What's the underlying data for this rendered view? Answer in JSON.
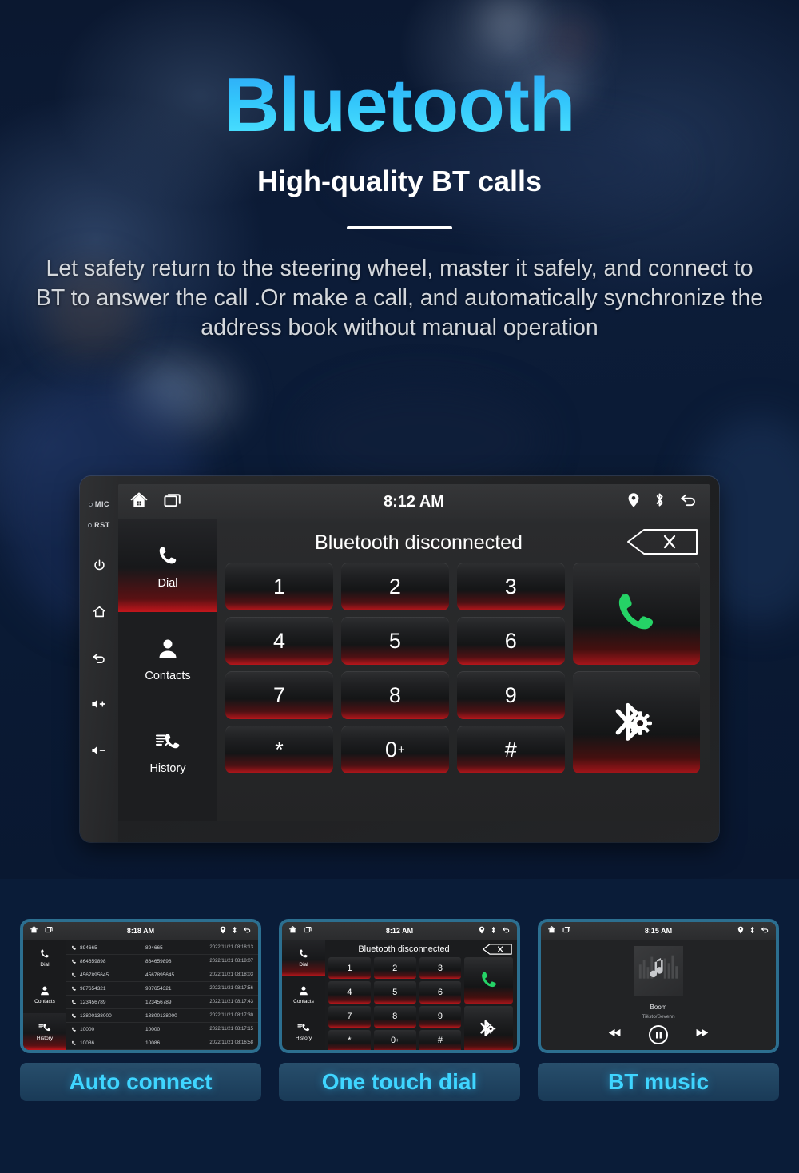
{
  "hero": {
    "headline": "Bluetooth",
    "subheadline": "High-quality BT calls",
    "body": "Let safety return to the steering wheel, master it safely, and connect to BT to answer the call .Or make a call, and automatically synchronize the address book without manual operation",
    "accent_color": "#35c8fa",
    "background_color": "#0a1c38"
  },
  "device": {
    "bezel": {
      "mic_label": "MIC",
      "rst_label": "RST",
      "buttons": [
        {
          "name": "power-button",
          "icon": "power-icon"
        },
        {
          "name": "home-button",
          "icon": "home-icon"
        },
        {
          "name": "back-button",
          "icon": "back-arrow-icon"
        },
        {
          "name": "volume-up-button",
          "icon": "volume-up-icon"
        },
        {
          "name": "volume-down-button",
          "icon": "volume-down-icon"
        }
      ]
    },
    "statusbar": {
      "clock": "8:12 AM",
      "left_icons": [
        "home-icon",
        "recents-icon"
      ],
      "right_icons": [
        "location-pin-icon",
        "bluetooth-icon",
        "back-arrow-icon"
      ]
    },
    "sidebar": [
      {
        "label": "Dial",
        "icon": "phone-icon",
        "active": true
      },
      {
        "label": "Contacts",
        "icon": "person-icon",
        "active": false
      },
      {
        "label": "History",
        "icon": "call-log-icon",
        "active": false
      }
    ],
    "bt_status": "Bluetooth disconnected",
    "backspace_icon": "backspace-x-icon",
    "keys": [
      "1",
      "2",
      "3",
      "4",
      "5",
      "6",
      "7",
      "8",
      "9",
      "*",
      "0",
      "#"
    ],
    "zero_suffix": "+",
    "call_button": {
      "name": "call-button",
      "icon": "phone-icon",
      "color": "#25d366"
    },
    "bt_settings_button": {
      "name": "bluetooth-settings-button",
      "icon": "bluetooth-gear-icon"
    }
  },
  "thumbnails": [
    {
      "caption": "Auto connect",
      "clock": "8:18 AM",
      "type": "history",
      "sidebar": [
        {
          "label": "Dial",
          "icon": "phone-icon",
          "active": false
        },
        {
          "label": "Contacts",
          "icon": "person-icon",
          "active": false
        },
        {
          "label": "History",
          "icon": "call-log-icon",
          "active": true
        }
      ],
      "rows": [
        {
          "number": "894665",
          "name": "894665",
          "time": "2022/11/21 08:18:13"
        },
        {
          "number": "864659898",
          "name": "864659898",
          "time": "2022/11/21 08:18:07"
        },
        {
          "number": "4567895645",
          "name": "4567895645",
          "time": "2022/11/21 08:18:03"
        },
        {
          "number": "987654321",
          "name": "987654321",
          "time": "2022/11/21 08:17:56"
        },
        {
          "number": "123456789",
          "name": "123456789",
          "time": "2022/11/21 08:17:43"
        },
        {
          "number": "13800138000",
          "name": "13800138000",
          "time": "2022/11/21 08:17:30"
        },
        {
          "number": "10000",
          "name": "10000",
          "time": "2022/11/21 08:17:15"
        },
        {
          "number": "10086",
          "name": "10086",
          "time": "2022/11/21 08:16:58"
        }
      ]
    },
    {
      "caption": "One touch dial",
      "clock": "8:12 AM",
      "type": "dialpad",
      "bt_status": "Bluetooth disconnected",
      "sidebar": [
        {
          "label": "Dial",
          "icon": "phone-icon",
          "active": true
        },
        {
          "label": "Contacts",
          "icon": "person-icon",
          "active": false
        },
        {
          "label": "History",
          "icon": "call-log-icon",
          "active": false
        }
      ],
      "keys": [
        "1",
        "2",
        "3",
        "4",
        "5",
        "6",
        "7",
        "8",
        "9",
        "*",
        "0",
        "#"
      ],
      "zero_suffix": "+"
    },
    {
      "caption": "BT music",
      "clock": "8:15 AM",
      "type": "music",
      "track": "Boom",
      "artist": "Tiësto/Sevenn",
      "controls": [
        "prev-icon",
        "pause-icon",
        "next-icon"
      ]
    }
  ]
}
